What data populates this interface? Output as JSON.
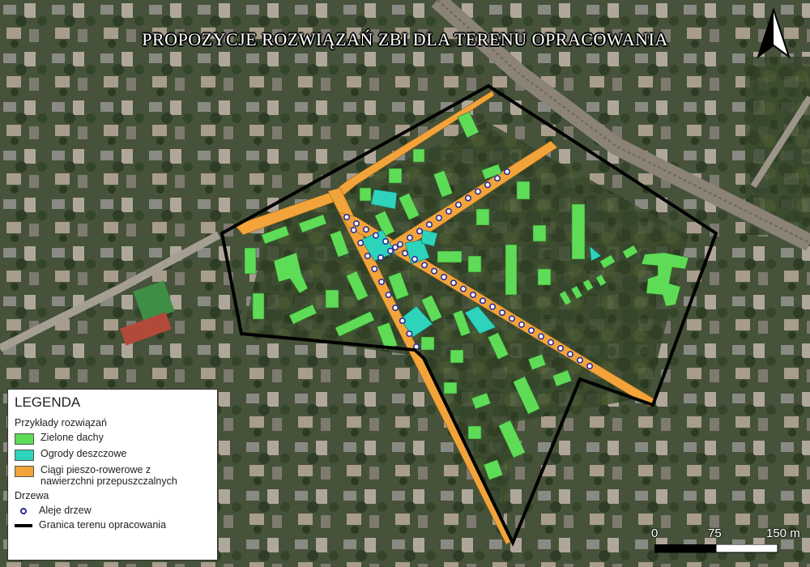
{
  "title": "PROPOZYCJE ROZWIĄZAŃ ZBI DLA TERENU OPRACOWANIA",
  "colors": {
    "green_roof": "#5fdc57",
    "rain_garden": "#2ed3bb",
    "path": "#f2a43a",
    "tree_dot_border": "#2b2b9a",
    "boundary": "#000000"
  },
  "legend": {
    "heading": "LEGENDA",
    "section_solutions": "Przykłady rozwiązań",
    "items": [
      {
        "label": "Zielone dachy",
        "color": "#5fdc57"
      },
      {
        "label": "Ogrody deszczowe",
        "color": "#2ed3bb"
      },
      {
        "label": "Ciągi pieszo-rowerowe z nawierzchni przepuszczalnych",
        "color": "#f2a43a"
      }
    ],
    "section_trees": "Drzewa",
    "tree_item": "Aleje drzew",
    "boundary_item": "Granica terenu opracowania"
  },
  "scale": {
    "labels": [
      "0",
      "75",
      "150 m"
    ]
  },
  "north_arrow_icon": "north-arrow-icon"
}
